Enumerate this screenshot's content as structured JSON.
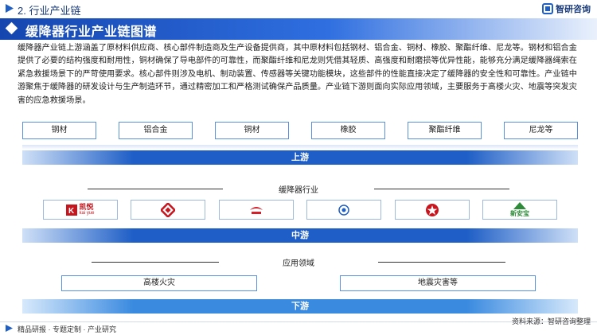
{
  "header": {
    "section_title": "2. 行业产业链",
    "brand_name": "智研咨询",
    "main_title": "缓降器行业产业链图谱"
  },
  "description": "缓降器产业链上游涵盖了原材料供应商、核心部件制造商及生产设备提供商，其中原材料包括钢材、铝合金、铜材、橡胶、聚酯纤维、尼龙等。钢材和铝合金提供了必要的结构强度和耐用性，铜材确保了导电部件的可靠性，而聚酯纤维和尼龙则凭借其轻质、高强度和耐磨损等优异性能，能够充分满足缓降器绳索在紧急救援场景下的严苛使用要求。核心部件则涉及电机、制动装置、传感器等关键功能模块，这些部件的性能直接决定了缓降器的安全性和可靠性。产业链中游聚焦于缓降器的研发设计与生产制造环节，通过精密加工和严格测试确保产品质量。产业链下游则面向实际应用领域，主要服务于高楼火灾、地震等突发灾害的应急救援场景。",
  "upstream": {
    "materials": [
      "钢材",
      "铝合金",
      "铜材",
      "橡胶",
      "聚酯纤维",
      "尼龙等"
    ],
    "label": "上游"
  },
  "midstream": {
    "heading": "缓降器行业",
    "logos": [
      {
        "text": "凯悦",
        "subtext": "kai yue",
        "color": "#c8151d"
      },
      {
        "text": "",
        "subtext": "",
        "color": "#c8151d"
      },
      {
        "text": "",
        "subtext": "",
        "color": "#d3202a"
      },
      {
        "text": "",
        "subtext": "",
        "color": "#1f5fc4"
      },
      {
        "text": "",
        "subtext": "",
        "color": "#c8151d"
      },
      {
        "text": "新安宝",
        "subtext": "",
        "color": "#2e8b3a"
      }
    ],
    "label": "中游"
  },
  "downstream": {
    "heading": "应用领域",
    "items": [
      "高楼火灾",
      "地震灾害等"
    ],
    "label": "下游"
  },
  "footer": {
    "left": "精品研报 · 专题定制 · 产业研究",
    "source": "资料来源：智研咨询整理"
  }
}
